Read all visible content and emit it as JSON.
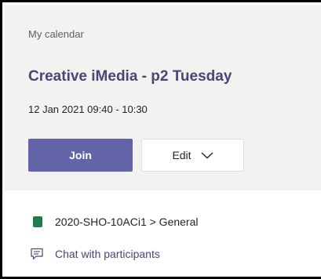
{
  "header": {
    "breadcrumb": "My calendar",
    "title": "Creative iMedia - p2 Tuesday",
    "datetime": "12 Jan 2021 09:40 - 10:30"
  },
  "actions": {
    "join_label": "Join",
    "edit_label": "Edit",
    "edit_icon": "chevron-down-icon"
  },
  "details": {
    "channel": {
      "icon": "team-icon",
      "label": "2020-SHO-10ACi1 > General"
    },
    "chat": {
      "icon": "chat-icon",
      "label": "Chat with participants"
    }
  },
  "colors": {
    "accent": "#6264a7",
    "title": "#464775",
    "team_icon": "#237b4b",
    "header_bg": "#f3f2f1"
  }
}
